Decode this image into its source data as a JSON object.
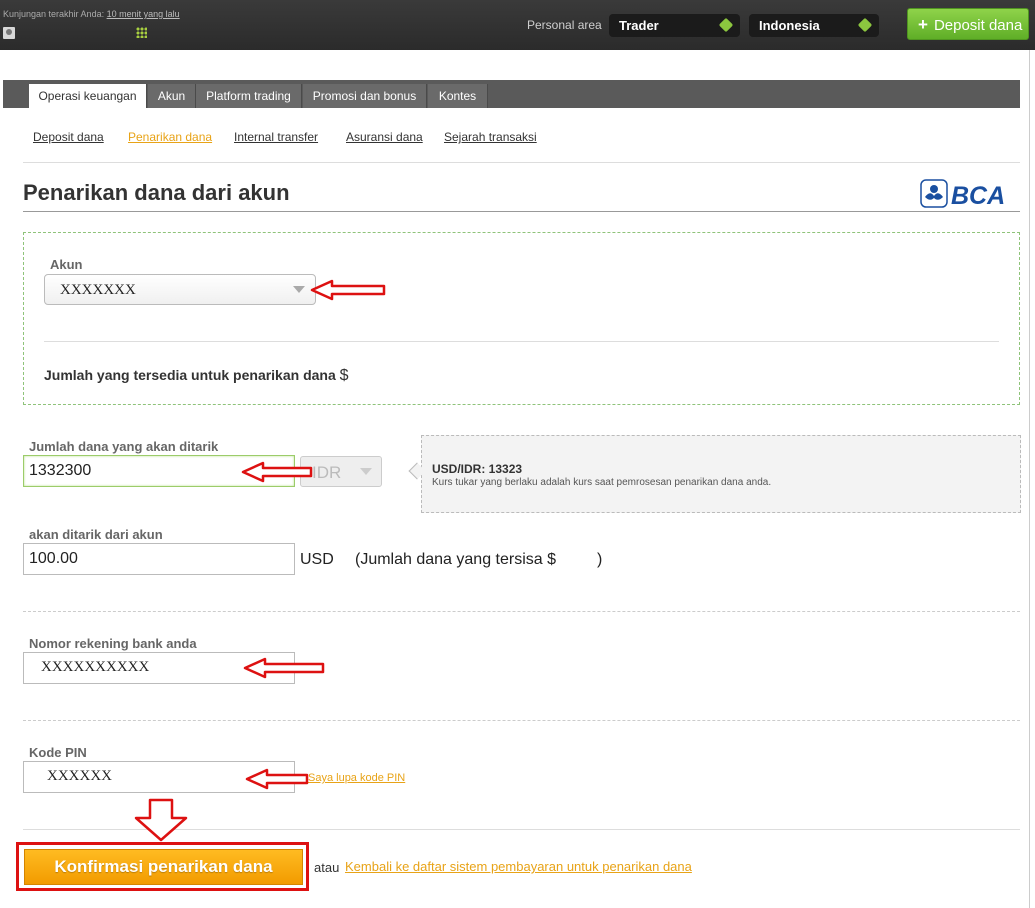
{
  "topbar": {
    "last_visit_label": "Kunjungan terakhir Anda:",
    "last_visit_value": "10 menit yang lalu",
    "personal_area_label": "Personal area",
    "account_type": "Trader",
    "country": "Indonesia",
    "deposit_button": "Deposit dana"
  },
  "tabs": [
    {
      "label": "Operasi keuangan",
      "active": true
    },
    {
      "label": "Akun"
    },
    {
      "label": "Platform trading"
    },
    {
      "label": "Promosi dan bonus"
    },
    {
      "label": "Kontes"
    }
  ],
  "subnav": [
    {
      "label": "Deposit dana"
    },
    {
      "label": "Penarikan dana",
      "active": true
    },
    {
      "label": "Internal transfer"
    },
    {
      "label": "Asuransi dana"
    },
    {
      "label": "Sejarah transaksi"
    }
  ],
  "page_title": "Penarikan dana dari akun",
  "bank_logo_text": "BCA",
  "form": {
    "account_label": "Akun",
    "account_value": "XXXXXXX",
    "available_label": "Jumlah yang tersedia untuk penarikan dana",
    "available_currency": "$",
    "amount_label": "Jumlah dana yang akan ditarik",
    "amount_value": "1332300",
    "amount_currency": "IDR",
    "rate_title": "USD/IDR: 13323",
    "rate_note": "Kurs tukar yang berlaku adalah kurs saat pemrosesan penarikan dana anda.",
    "debit_label": "akan ditarik dari akun",
    "debit_value": "100.00",
    "debit_currency": "USD",
    "remaining_text": "(Jumlah dana yang tersisa $",
    "remaining_close": ")",
    "bank_account_label": "Nomor rekening bank anda",
    "bank_account_value": "XXXXXXXXXX",
    "pin_label": "Kode PIN",
    "pin_value": "XXXXXX",
    "forgot_pin": "Saya lupa kode PIN"
  },
  "actions": {
    "confirm_button": "Konfirmasi penarikan dana",
    "or_text": "atau",
    "back_link": "Kembali ke daftar sistem pembayaran untuk penarikan dana"
  },
  "colors": {
    "accent_orange": "#f29b00",
    "link_orange": "#e8a317",
    "green_button": "#5fae27",
    "annotation_red": "#dd1111",
    "bca_blue": "#1a4fa0"
  }
}
